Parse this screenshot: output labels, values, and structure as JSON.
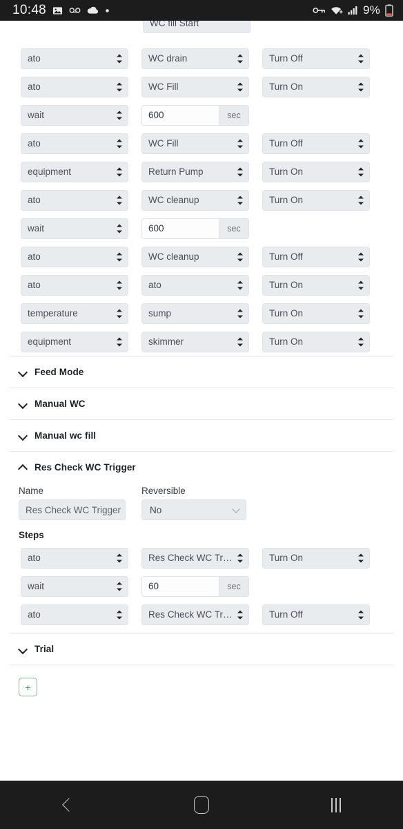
{
  "statusbar": {
    "time": "10:48",
    "icons_left": [
      "image-icon",
      "voicemail-icon",
      "cloud-icon",
      "dot-icon"
    ],
    "icons_right": [
      "vpn-key-icon",
      "wifi-icon",
      "signal-icon"
    ],
    "battery_text": "9%",
    "battery_icon": "battery-low-icon"
  },
  "clipped_row": {
    "value": "WC fill Start"
  },
  "steps": [
    {
      "type": "ato",
      "target": "WC drain",
      "action": "Turn Off"
    },
    {
      "type": "ato",
      "target": "WC Fill",
      "action": "Turn On"
    },
    {
      "type": "wait",
      "duration": "600",
      "unit": "sec"
    },
    {
      "type": "ato",
      "target": "WC Fill",
      "action": "Turn Off"
    },
    {
      "type": "equipment",
      "target": "Return Pump",
      "action": "Turn On"
    },
    {
      "type": "ato",
      "target": "WC cleanup",
      "action": "Turn On"
    },
    {
      "type": "wait",
      "duration": "600",
      "unit": "sec"
    },
    {
      "type": "ato",
      "target": "WC cleanup",
      "action": "Turn Off"
    },
    {
      "type": "ato",
      "target": "ato",
      "action": "Turn On"
    },
    {
      "type": "temperature",
      "target": "sump",
      "action": "Turn On"
    },
    {
      "type": "equipment",
      "target": "skimmer",
      "action": "Turn On"
    }
  ],
  "sections": [
    {
      "title": "Feed Mode",
      "expanded": false
    },
    {
      "title": "Manual WC",
      "expanded": false
    },
    {
      "title": "Manual wc fill",
      "expanded": false
    },
    {
      "title": "Res Check WC Trigger",
      "expanded": true
    },
    {
      "title": "Trial",
      "expanded": false
    }
  ],
  "expanded_section": {
    "title": "Res Check WC Trigger",
    "name_label": "Name",
    "name_value": "Res Check WC Trigger",
    "reversible_label": "Reversible",
    "reversible_value": "No",
    "steps_label": "Steps",
    "steps": [
      {
        "type": "ato",
        "target": "Res Check WC Trigger",
        "action": "Turn On"
      },
      {
        "type": "wait",
        "duration": "60",
        "unit": "sec"
      },
      {
        "type": "ato",
        "target": "Res Check WC Trigger",
        "action": "Turn Off"
      }
    ]
  },
  "add_button": {
    "label": "+",
    "color": "#3f8f52"
  },
  "navbar": {
    "back": "back-icon",
    "home": "home-icon",
    "recents": "recents-icon"
  },
  "colors": {
    "control_bg": "#e9ecef",
    "control_border": "#dfe3e7",
    "text": "#4a4f55",
    "statusbar_bg": "#1c1c1c",
    "accent_green": "#3f8f52"
  }
}
